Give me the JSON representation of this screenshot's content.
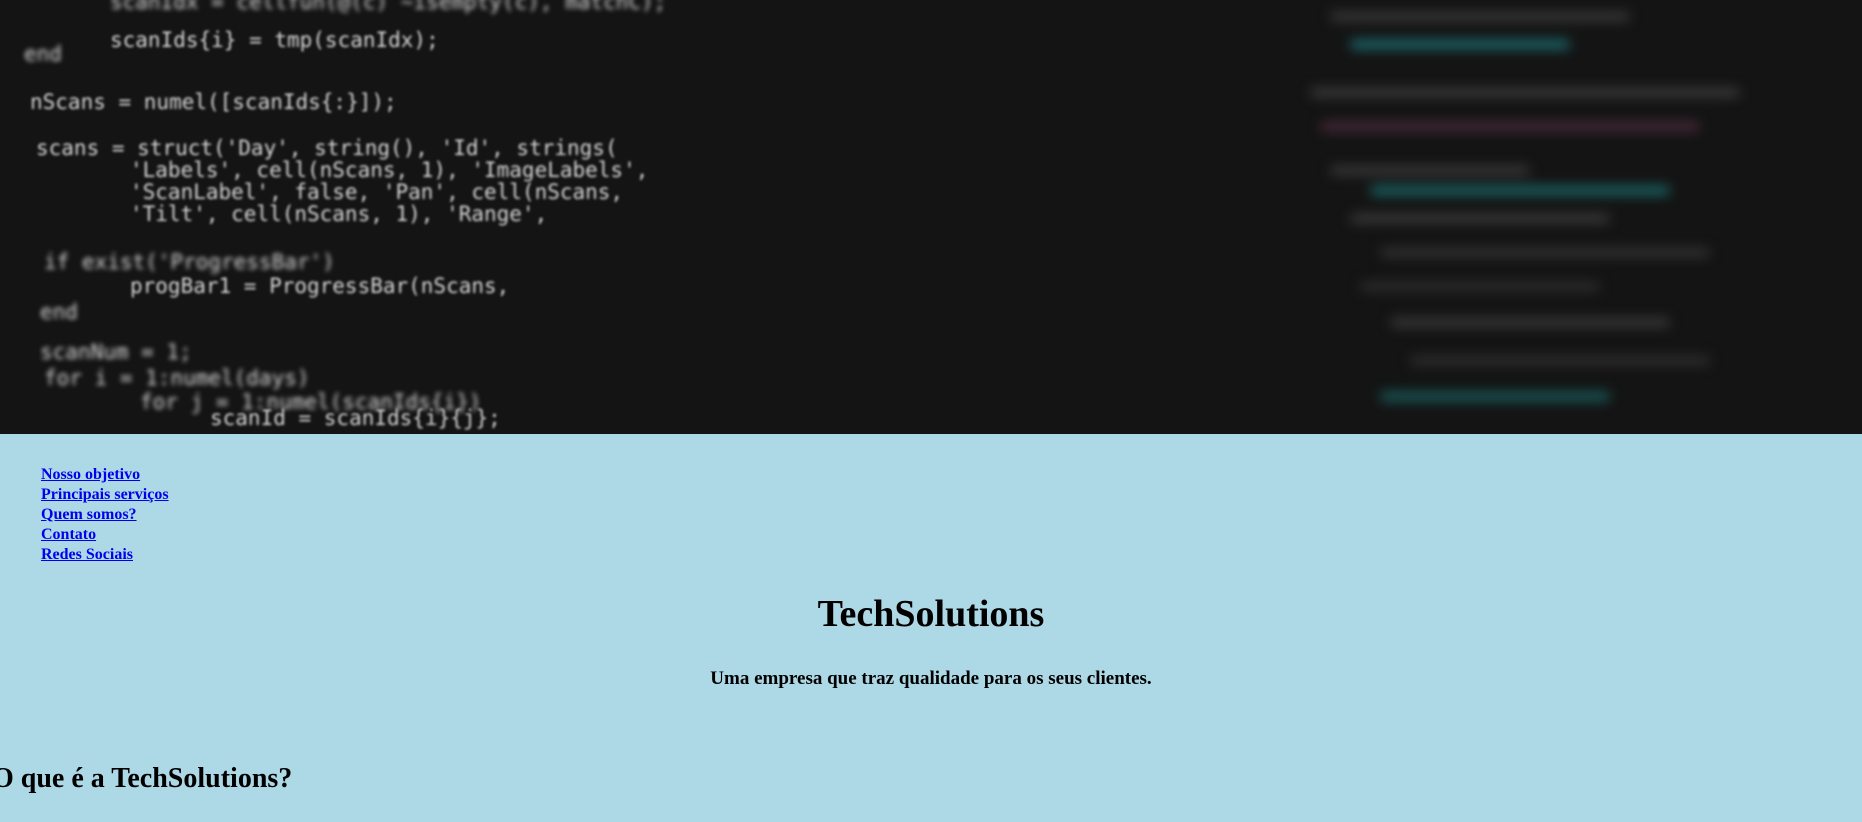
{
  "hero": {
    "image": "code-screenshot-background",
    "code_lines": [
      "scanIdx = cellfun(@(c) ~isempty(c), matchC);",
      "scanIds{i} = tmp(scanIdx);",
      "end",
      "nScans = numel([scanIds{:}]);",
      "scans = struct('Day', string(), 'Id', strings(",
      "'Labels', cell(nScans, 1), 'ImageLabels',",
      "'ScanLabel', false, 'Pan', cell(nScans,",
      "'Tilt', cell(nScans, 1), 'Range',",
      "if exist('ProgressBar')",
      "progBar1 = ProgressBar(nScans,",
      "end",
      "scanNum = 1;",
      "for i = 1:numel(days)",
      "for j = 1:numel(scanIds{i})",
      "scanId = scanIds{i}{j};"
    ]
  },
  "nav": {
    "items": [
      {
        "label": "Nosso objetivo"
      },
      {
        "label": "Principais serviços"
      },
      {
        "label": "Quem somos?"
      },
      {
        "label": "Contato"
      },
      {
        "label": "Redes Sociais"
      }
    ]
  },
  "header": {
    "title": "TechSolutions",
    "subtitle": "Uma empresa que traz qualidade para os seus clientes."
  },
  "sections": {
    "about_title": "O que é a TechSolutions?"
  },
  "colors": {
    "page_background": "#add8e6",
    "link": "#0000ee",
    "hero_background": "#141414"
  }
}
